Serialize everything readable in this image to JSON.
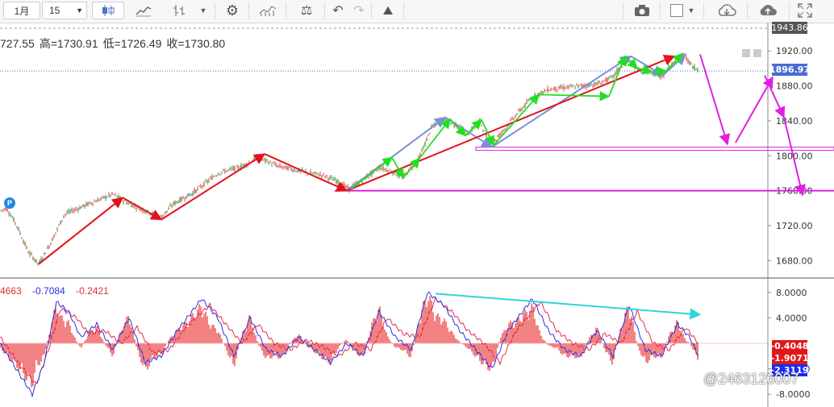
{
  "toolbar": {
    "period_label": "1月",
    "interval_value": "15",
    "icons": [
      "candlestick-icon",
      "line-chart-icon",
      "ohlc-bars-icon",
      "dropdown-icon",
      "gear-icon",
      "indicator-icon",
      "balance-icon",
      "undo-icon",
      "redo-icon",
      "drawing-pin-icon",
      "camera-icon",
      "color-box-icon",
      "cloud-download-icon",
      "cloud-upload-icon",
      "fullscreen-icon"
    ]
  },
  "ohlc": {
    "open": "727.55",
    "high_label": "高=",
    "high": "1730.91",
    "low_label": "低=",
    "low": "1726.49",
    "close_label": "收=",
    "close": "1730.80"
  },
  "indicator_values": {
    "v1": "4663",
    "v2": "-0.7084",
    "v3": "-0.2421"
  },
  "colors": {
    "up": "#2e7d32",
    "down": "#d32f2f",
    "arrow_red": "#e3121b",
    "arrow_green": "#22e01e",
    "arrow_blue": "#7d8fd6",
    "magenta": "#e020e0",
    "cyan": "#2fd4dc",
    "macd_fast": "#3030e0",
    "macd_slow": "#e03050",
    "price_badge": "#4b6ccf"
  },
  "watermark": "@2463126007",
  "p_marker": "P",
  "chart_data": {
    "type": "candlestick",
    "price_axis": {
      "ylim": [
        1660,
        1946
      ],
      "ticks": [
        1680,
        1720,
        1760,
        1800,
        1840,
        1880,
        1920
      ],
      "tick_labels": [
        "1680.00",
        "1720.00",
        "1760.00",
        "1800.00",
        "1840.00",
        "1880.00",
        "1920.00"
      ],
      "top_label": "1943.86",
      "current_price": "1896.97"
    },
    "price_path": [
      [
        0,
        1737
      ],
      [
        8,
        1740
      ],
      [
        20,
        1722
      ],
      [
        35,
        1690
      ],
      [
        48,
        1676
      ],
      [
        60,
        1695
      ],
      [
        80,
        1733
      ],
      [
        110,
        1745
      ],
      [
        140,
        1756
      ],
      [
        160,
        1745
      ],
      [
        185,
        1735
      ],
      [
        200,
        1730
      ],
      [
        215,
        1745
      ],
      [
        240,
        1758
      ],
      [
        270,
        1780
      ],
      [
        300,
        1788
      ],
      [
        320,
        1798
      ],
      [
        345,
        1788
      ],
      [
        380,
        1781
      ],
      [
        400,
        1778
      ],
      [
        420,
        1770
      ],
      [
        432,
        1762
      ],
      [
        450,
        1772
      ],
      [
        470,
        1787
      ],
      [
        485,
        1782
      ],
      [
        500,
        1775
      ],
      [
        520,
        1798
      ],
      [
        535,
        1832
      ],
      [
        550,
        1842
      ],
      [
        565,
        1835
      ],
      [
        580,
        1825
      ],
      [
        595,
        1840
      ],
      [
        608,
        1812
      ],
      [
        625,
        1830
      ],
      [
        640,
        1847
      ],
      [
        660,
        1867
      ],
      [
        680,
        1876
      ],
      [
        700,
        1878
      ],
      [
        720,
        1880
      ],
      [
        740,
        1882
      ],
      [
        760,
        1890
      ],
      [
        775,
        1910
      ],
      [
        790,
        1900
      ],
      [
        810,
        1893
      ],
      [
        820,
        1890
      ],
      [
        835,
        1908
      ],
      [
        848,
        1915
      ],
      [
        858,
        1903
      ],
      [
        866,
        1898
      ]
    ],
    "price_lines": {
      "upper": 1808,
      "lower": 1760
    },
    "arrows_red": [
      [
        [
          48,
          1676
        ],
        [
          152,
          1752
        ]
      ],
      [
        [
          152,
          1752
        ],
        [
          200,
          1727
        ]
      ],
      [
        [
          200,
          1727
        ],
        [
          328,
          1802
        ]
      ],
      [
        [
          328,
          1802
        ],
        [
          430,
          1760
        ]
      ],
      [
        [
          430,
          1760
        ],
        [
          836,
          1914
        ]
      ]
    ],
    "arrows_blue": [
      [
        [
          430,
          1760
        ],
        [
          552,
          1844
        ]
      ],
      [
        [
          552,
          1844
        ],
        [
          610,
          1810
        ]
      ],
      [
        [
          610,
          1810
        ],
        [
          782,
          1914
        ]
      ],
      [
        [
          782,
          1914
        ],
        [
          822,
          1892
        ]
      ],
      [
        [
          822,
          1892
        ],
        [
          850,
          1916
        ]
      ]
    ],
    "arrows_green": [
      [
        [
          435,
          1762
        ],
        [
          486,
          1798
        ]
      ],
      [
        [
          486,
          1798
        ],
        [
          500,
          1775
        ]
      ],
      [
        [
          500,
          1775
        ],
        [
          520,
          1797
        ]
      ],
      [
        [
          520,
          1797
        ],
        [
          558,
          1842
        ]
      ],
      [
        [
          558,
          1842
        ],
        [
          577,
          1823
        ]
      ],
      [
        [
          577,
          1823
        ],
        [
          597,
          1841
        ]
      ],
      [
        [
          597,
          1841
        ],
        [
          612,
          1812
        ]
      ],
      [
        [
          612,
          1812
        ],
        [
          668,
          1870
        ]
      ],
      [
        [
          668,
          1870
        ],
        [
          755,
          1868
        ]
      ],
      [
        [
          755,
          1868
        ],
        [
          775,
          1914
        ]
      ],
      [
        [
          775,
          1914
        ],
        [
          790,
          1900
        ]
      ],
      [
        [
          790,
          1900
        ],
        [
          808,
          1896
        ]
      ],
      [
        [
          808,
          1896
        ],
        [
          826,
          1897
        ]
      ],
      [
        [
          826,
          1897
        ],
        [
          846,
          1917
        ]
      ]
    ],
    "arrows_magenta": [
      [
        [
          868,
          1916
        ],
        [
          902,
          1813
        ]
      ],
      [
        [
          912,
          1815
        ],
        [
          958,
          1890
        ]
      ],
      [
        [
          948,
          1892
        ],
        [
          972,
          1844
        ]
      ],
      [
        [
          972,
          1844
        ],
        [
          995,
          1755
        ]
      ]
    ],
    "indicator_axis": {
      "ylim": [
        -10,
        10
      ],
      "ticks": [
        8,
        4,
        -4,
        -8
      ],
      "tick_labels": [
        "8.0000",
        "4.0000",
        "-4.0000",
        "-8.0000"
      ],
      "badges": [
        "-0.4048",
        "-1.9071",
        "-2.3119"
      ]
    },
    "macd_fast": [
      [
        0,
        0
      ],
      [
        20,
        -4
      ],
      [
        40,
        -8
      ],
      [
        55,
        -3
      ],
      [
        70,
        6.5
      ],
      [
        85,
        5
      ],
      [
        100,
        1
      ],
      [
        120,
        3
      ],
      [
        140,
        -1
      ],
      [
        160,
        4
      ],
      [
        180,
        -3
      ],
      [
        200,
        -2
      ],
      [
        220,
        2
      ],
      [
        250,
        7
      ],
      [
        270,
        4
      ],
      [
        290,
        -2
      ],
      [
        310,
        4
      ],
      [
        330,
        -1
      ],
      [
        350,
        -2
      ],
      [
        370,
        1
      ],
      [
        390,
        -1
      ],
      [
        410,
        -3
      ],
      [
        430,
        0
      ],
      [
        450,
        -2
      ],
      [
        470,
        5
      ],
      [
        490,
        1
      ],
      [
        510,
        -1
      ],
      [
        530,
        8
      ],
      [
        550,
        6
      ],
      [
        570,
        2
      ],
      [
        590,
        -1
      ],
      [
        610,
        -4
      ],
      [
        630,
        2
      ],
      [
        660,
        7
      ],
      [
        680,
        2
      ],
      [
        700,
        -1
      ],
      [
        720,
        -2
      ],
      [
        740,
        2
      ],
      [
        760,
        -2
      ],
      [
        780,
        6
      ],
      [
        800,
        -1
      ],
      [
        820,
        -2
      ],
      [
        840,
        3
      ],
      [
        855,
        1
      ],
      [
        866,
        -2
      ]
    ],
    "macd_slow": [
      [
        0,
        1
      ],
      [
        22,
        -3
      ],
      [
        45,
        -6.5
      ],
      [
        60,
        -1
      ],
      [
        75,
        5.5
      ],
      [
        95,
        4
      ],
      [
        110,
        1.5
      ],
      [
        130,
        2
      ],
      [
        150,
        0
      ],
      [
        170,
        2.5
      ],
      [
        190,
        -1.5
      ],
      [
        210,
        -1
      ],
      [
        230,
        2.5
      ],
      [
        260,
        6
      ],
      [
        280,
        3
      ],
      [
        300,
        0
      ],
      [
        320,
        3
      ],
      [
        340,
        0
      ],
      [
        360,
        -1
      ],
      [
        380,
        0.5
      ],
      [
        400,
        -0.5
      ],
      [
        420,
        -2
      ],
      [
        440,
        0
      ],
      [
        460,
        -1
      ],
      [
        480,
        4
      ],
      [
        500,
        1.5
      ],
      [
        520,
        1
      ],
      [
        540,
        7
      ],
      [
        560,
        5
      ],
      [
        580,
        2
      ],
      [
        600,
        0
      ],
      [
        620,
        -3
      ],
      [
        640,
        2
      ],
      [
        670,
        6.5
      ],
      [
        690,
        2
      ],
      [
        710,
        0
      ],
      [
        730,
        -1
      ],
      [
        750,
        1.5
      ],
      [
        770,
        0
      ],
      [
        790,
        5
      ],
      [
        810,
        0
      ],
      [
        830,
        -1
      ],
      [
        850,
        2.5
      ],
      [
        866,
        0
      ]
    ],
    "divergence_line": [
      [
        540,
        7.8
      ],
      [
        868,
        4.5
      ]
    ]
  }
}
